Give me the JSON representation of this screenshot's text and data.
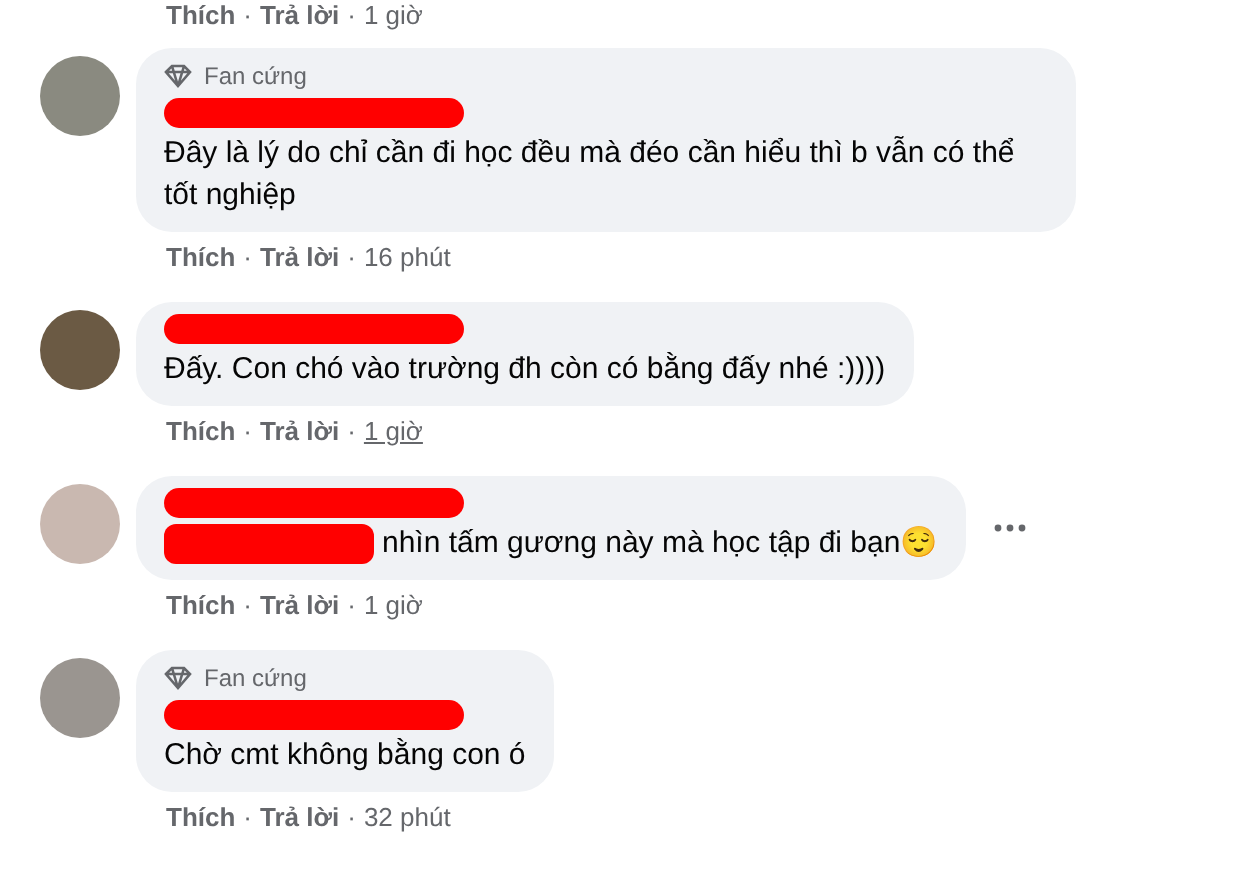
{
  "top_actions": {
    "like": "Thích",
    "sep": "·",
    "reply": "Trả lời",
    "time": "1 giờ"
  },
  "comments": [
    {
      "badge": "Fan cứng",
      "text": "Đây là lý do chỉ cần đi học đều mà đéo cần hiểu thì b vẫn có thể tốt nghiệp",
      "name_redacted": true,
      "actions": {
        "like": "Thích",
        "sep": "·",
        "reply": "Trả lời",
        "time": "16 phút"
      }
    },
    {
      "text": "Đấy. Con chó vào trường đh còn có bằng đấy nhé :))))",
      "name_redacted": true,
      "actions": {
        "like": "Thích",
        "sep": "·",
        "reply": "Trả lời",
        "time": "1 giờ",
        "time_underlined": true
      }
    },
    {
      "text": "nhìn tấm gương này mà học tập đi bạn😌",
      "name_redacted": true,
      "mention_redacted": true,
      "more_button": true,
      "actions": {
        "like": "Thích",
        "sep": "·",
        "reply": "Trả lời",
        "time": "1 giờ"
      }
    },
    {
      "badge": "Fan cứng",
      "text": "Chờ cmt không bằng con ó",
      "name_redacted": true,
      "actions": {
        "like": "Thích",
        "sep": "·",
        "reply": "Trả lời",
        "time": "32 phút"
      }
    }
  ]
}
